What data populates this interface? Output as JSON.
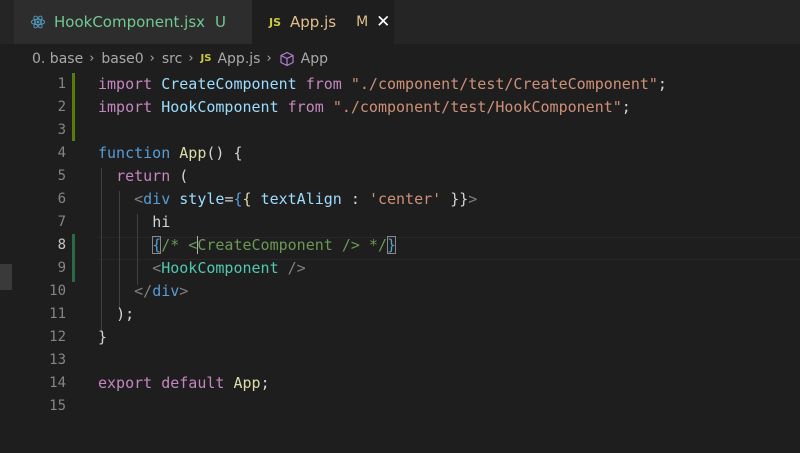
{
  "tabs": [
    {
      "label": "HookComponent.jsx",
      "status": "U",
      "icon": "react-icon"
    },
    {
      "label": "App.js",
      "status": "M",
      "icon": "js-icon",
      "badge": "JS",
      "close": "✕"
    }
  ],
  "breadcrumb": {
    "items": [
      "0. base",
      "base0",
      "src",
      "App.js",
      "App"
    ],
    "separator": "›",
    "js_badge": "JS"
  },
  "editor": {
    "line_numbers": [
      "1",
      "2",
      "3",
      "4",
      "5",
      "6",
      "7",
      "8",
      "9",
      "10",
      "11",
      "12",
      "13",
      "14",
      "15"
    ],
    "current_line": "8",
    "tokens": {
      "l1_import": "import",
      "l1_name": "CreateComponent",
      "l1_from": "from",
      "l1_path": "\"./component/test/CreateComponent\"",
      "l1_semi": ";",
      "l2_import": "import",
      "l2_name": "HookComponent",
      "l2_from": "from",
      "l2_path": "\"./component/test/HookComponent\"",
      "l2_semi": ";",
      "l4_function": "function",
      "l4_name": "App",
      "l4_rest": "() {",
      "l5_return": "return",
      "l5_paren": " (",
      "l6_open": "<",
      "l6_tag": "div",
      "l6_attr": "style",
      "l6_eq": "=",
      "l6_brace1": "{",
      "l6_brace2": "{",
      "l6_prop": "textAlign",
      "l6_colon": " : ",
      "l6_str": "'center'",
      "l6_close": " }}",
      "l6_gt": ">",
      "l7_text": "hi",
      "l8_lbrace": "{",
      "l8_c1": "/* <",
      "l8_c2": "CreateComponent /> */",
      "l8_rbrace": "}",
      "l9_open": "<",
      "l9_tag": "HookComponent",
      "l9_close": " />",
      "l10_open": "</",
      "l10_tag": "div",
      "l10_gt": ">",
      "l11_text": ");",
      "l12_text": "}",
      "l14_export": "export",
      "l14_default": "default",
      "l14_name": "App",
      "l14_semi": ";"
    }
  },
  "colors": {
    "keyword": "#c586c0",
    "keyword_blue": "#569cd6",
    "function": "#dcdcaa",
    "string": "#ce9178",
    "component": "#4ec9b0",
    "comment": "#6a9955",
    "git_added": "#587c0c"
  }
}
